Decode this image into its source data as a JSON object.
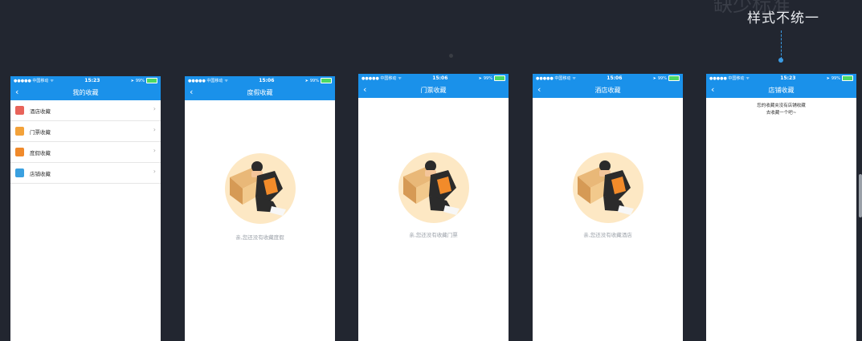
{
  "annotation": {
    "ghost_text": "缺少标准",
    "label": "样式不统一"
  },
  "status_common": {
    "carrier": "●●●●● 中国移动",
    "battery": "99%"
  },
  "screens": [
    {
      "time": "15:23",
      "title": "我的收藏",
      "items": [
        {
          "label": "酒店收藏",
          "color": "#e8635a"
        },
        {
          "label": "门票收藏",
          "color": "#f3a23a"
        },
        {
          "label": "度假收藏",
          "color": "#f08a2b"
        },
        {
          "label": "店铺收藏",
          "color": "#3aa0e0"
        }
      ]
    },
    {
      "time": "15:06",
      "title": "度假收藏",
      "empty_text": "亲,您还没有收藏度假"
    },
    {
      "time": "15:06",
      "title": "门票收藏",
      "empty_text": "亲,您还没有收藏门票"
    },
    {
      "time": "15:06",
      "title": "酒店收藏",
      "empty_text": "亲,您还没有收藏酒店"
    },
    {
      "time": "15:23",
      "title": "店铺收藏",
      "msg_line1": "您的收藏夹没有店铺收藏",
      "msg_line2": "去收藏一个吧~"
    }
  ]
}
